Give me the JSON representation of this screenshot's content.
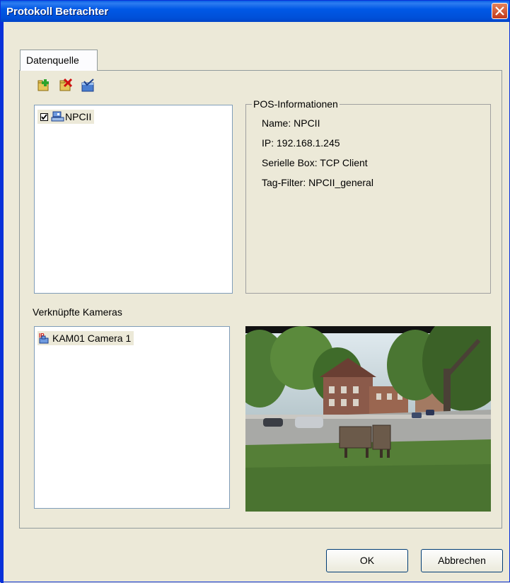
{
  "window": {
    "title": "Protokoll Betrachter"
  },
  "tabs": [
    {
      "label": "Datenquelle"
    }
  ],
  "toolbar": {
    "buttons": [
      {
        "name": "add",
        "icon": "add-source-icon"
      },
      {
        "name": "remove",
        "icon": "remove-source-icon"
      },
      {
        "name": "edit",
        "icon": "edit-source-icon"
      }
    ]
  },
  "sources": [
    {
      "label": "NPCII",
      "checked": true
    }
  ],
  "pos_info": {
    "legend": "POS-Informationen",
    "lines": [
      "Name: NPCII",
      "IP: 192.168.1.245",
      "Serielle Box: TCP Client",
      "Tag-Filter: NPCII_general"
    ]
  },
  "cameras": {
    "label": "Verknüpfte Kameras",
    "items": [
      {
        "label": "KAM01 Camera 1",
        "badge": "IP"
      }
    ]
  },
  "buttons": {
    "ok": "OK",
    "cancel": "Abbrechen"
  },
  "colors": {
    "titlebar": "#0058e6",
    "dialog_bg": "#ece9d8",
    "list_border": "#7f9db9"
  }
}
